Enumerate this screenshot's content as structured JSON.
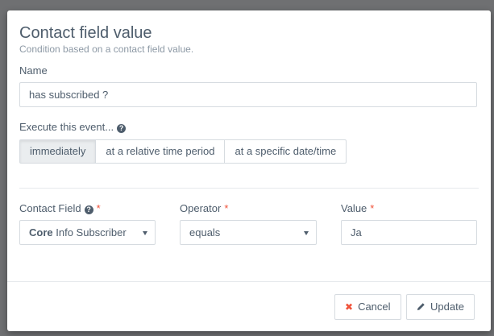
{
  "modal": {
    "title": "Contact field value",
    "subtitle": "Condition based on a contact field value."
  },
  "name": {
    "label": "Name",
    "value": "has subscribed ?"
  },
  "execute": {
    "label": "Execute this event...",
    "options": [
      "immediately",
      "at a relative time period",
      "at a specific date/time"
    ],
    "selected": "immediately"
  },
  "contact_field": {
    "label": "Contact Field",
    "required_mark": "*",
    "group": "Core",
    "value": "Info Subscriber"
  },
  "operator": {
    "label": "Operator",
    "required_mark": "*",
    "value": "equals"
  },
  "value_field": {
    "label": "Value",
    "required_mark": "*",
    "value": "Ja"
  },
  "footer": {
    "cancel_label": "Cancel",
    "update_label": "Update"
  },
  "colors": {
    "text": "#4e5d6c",
    "required": "#f0523a",
    "backdrop": "#6f7072"
  },
  "icons": [
    "question-circle-icon",
    "chevron-down-icon",
    "close-icon",
    "pencil-icon"
  ]
}
